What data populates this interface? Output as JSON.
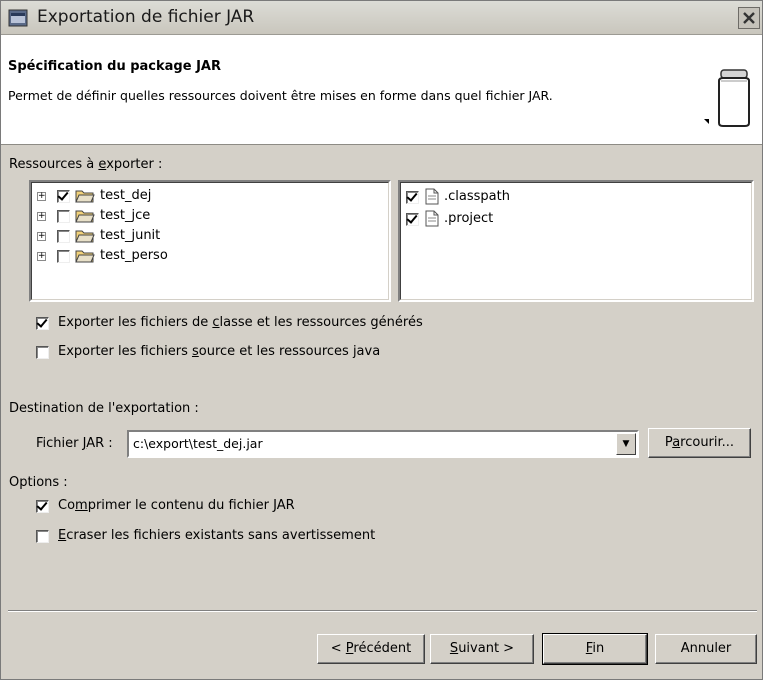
{
  "window": {
    "title": "Exportation de fichier JAR"
  },
  "banner": {
    "title": "Spécification du package JAR",
    "description": "Permet de définir quelles ressources doivent être mises en forme dans quel fichier JAR."
  },
  "resources": {
    "label_pre": "Ressources à ",
    "label_u": "e",
    "label_post": "xporter :",
    "projects": [
      {
        "name": "test_dej",
        "checked": true
      },
      {
        "name": "test_jce",
        "checked": false
      },
      {
        "name": "test_junit",
        "checked": false
      },
      {
        "name": "test_perso",
        "checked": false
      }
    ],
    "files": [
      {
        "name": ".classpath",
        "checked": true
      },
      {
        "name": ".project",
        "checked": true
      }
    ]
  },
  "options_export": {
    "class_pre": "Exporter les fichiers de ",
    "class_u": "c",
    "class_post": "lasse et les ressources générés",
    "class_checked": true,
    "source_pre": "Exporter les fichiers ",
    "source_u": "s",
    "source_post": "ource et les ressources java",
    "source_checked": false
  },
  "destination": {
    "label": "Destination de l'exportation :",
    "file_label_pre": "Fichier ",
    "file_label_u": "J",
    "file_label_post": "AR :",
    "value": "c:\\export\\test_dej.jar",
    "browse_pre": "P",
    "browse_u": "a",
    "browse_post": "rcourir..."
  },
  "options": {
    "label": "Options :",
    "compress_pre": "Co",
    "compress_u": "m",
    "compress_post": "primer le contenu du fichier JAR",
    "compress_checked": true,
    "overwrite_u": "E",
    "overwrite_post": "craser les fichiers existants sans avertissement",
    "overwrite_checked": false
  },
  "buttons": {
    "back_pre": "< ",
    "back_u": "P",
    "back_post": "récédent",
    "next_u": "S",
    "next_post": "uivant >",
    "finish_u": "F",
    "finish_post": "in",
    "cancel": "Annuler"
  }
}
